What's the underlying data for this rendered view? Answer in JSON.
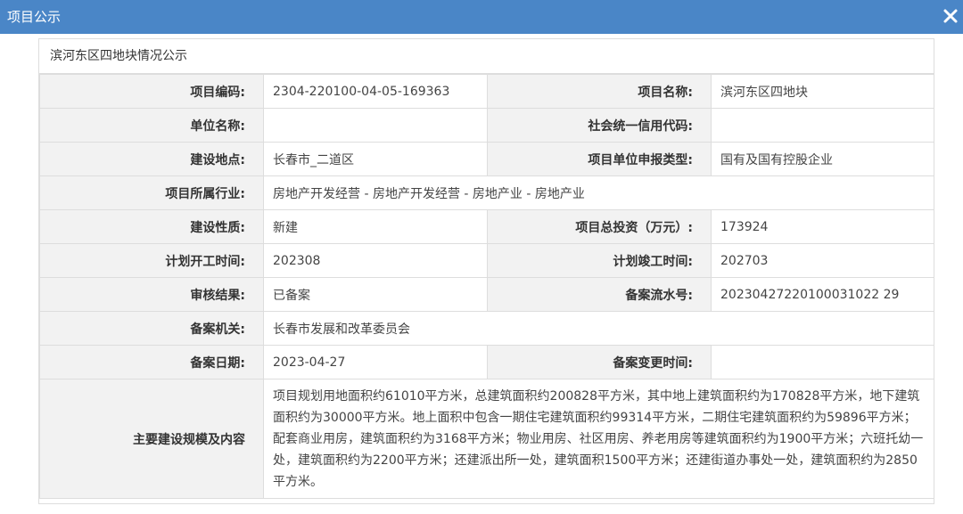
{
  "dialog": {
    "title": "项目公示",
    "close_icon": "close-icon",
    "header_color": "#4a86c7"
  },
  "panel": {
    "caption": "滨河东区四地块情况公示"
  },
  "rows": {
    "r1": {
      "l1": "项目编码:",
      "v1": "2304-220100-04-05-169363",
      "l2": "项目名称:",
      "v2": "滨河东区四地块"
    },
    "r2": {
      "l1": "单位名称:",
      "v1": "",
      "l2": "社会统一信用代码:",
      "v2": ""
    },
    "r3": {
      "l1": "建设地点:",
      "v1": "长春市_二道区",
      "l2": "项目单位申报类型:",
      "v2": "国有及国有控股企业"
    },
    "r4": {
      "l1": "项目所属行业:",
      "v1": "房地产开发经营 - 房地产开发经营 - 房地产业 - 房地产业"
    },
    "r5": {
      "l1": "建设性质:",
      "v1": "新建",
      "l2": "项目总投资（万元）:",
      "v2": "173924"
    },
    "r6": {
      "l1": "计划开工时间:",
      "v1": "202308",
      "l2": "计划竣工时间:",
      "v2": "202703"
    },
    "r7": {
      "l1": "审核结果:",
      "v1": "已备案",
      "l2": "备案流水号:",
      "v2": "20230427220100031022 29"
    },
    "r8": {
      "l1": "备案机关:",
      "v1": "长春市发展和改革委员会"
    },
    "r9": {
      "l1": "备案日期:",
      "v1": "2023-04-27",
      "l2": "备案变更时间:",
      "v2": ""
    },
    "r10": {
      "l1": "主要建设规模及内容",
      "v1": "项目规划用地面积约61010平方米，总建筑面积约200828平方米，其中地上建筑面积约为170828平方米，地下建筑面积约为30000平方米。地上面积中包含一期住宅建筑面积约99314平方米，二期住宅建筑面积约为59896平方米；配套商业用房，建筑面积约为3168平方米；物业用房、社区用房、养老用房等建筑面积约为1900平方米；六班托幼一处，建筑面积约为2200平方米；还建派出所一处，建筑面积1500平方米；还建街道办事处一处，建筑面积约为2850平方米。"
    }
  }
}
